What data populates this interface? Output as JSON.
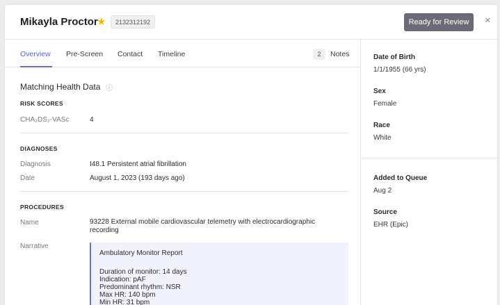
{
  "header": {
    "patient_name": "Mikayla Proctor",
    "patient_id": "2132312192",
    "ready_label": "Ready for Review",
    "close_symbol": "×"
  },
  "tabs": [
    {
      "label": "Overview",
      "active": true
    },
    {
      "label": "Pre-Screen",
      "active": false
    },
    {
      "label": "Contact",
      "active": false
    },
    {
      "label": "Timeline",
      "active": false
    }
  ],
  "notes": {
    "count": "2",
    "label": "Notes"
  },
  "main": {
    "section_title": "Matching Health Data",
    "risk_scores": {
      "heading": "RISK SCORES",
      "label": "CHA₂DS₂-VASc",
      "value": "4"
    },
    "diagnoses": {
      "heading": "DIAGNOSES",
      "diagnosis_label": "Diagnosis",
      "diagnosis_value": "I48.1 Persistent atrial fibrillation",
      "date_label": "Date",
      "date_value": "August 1, 2023 (193 days ago)"
    },
    "procedures": {
      "heading": "PROCEDURES",
      "name_label": "Name",
      "name_value": "93228 External mobile cardiovascular telemetry with electrocardiographic recording",
      "narrative_label": "Narrative",
      "report_title": "Ambulatory Monitor Report",
      "report_lines": [
        "Duration of monitor: 14 days",
        "Indication: pAF",
        "Predominant rhythm: NSR",
        "Max HR: 140 bpm",
        "Min HR: 31 bpm"
      ]
    }
  },
  "sidebar": {
    "dob_label": "Date of Birth",
    "dob_value": "1/1/1955 (66 yrs)",
    "sex_label": "Sex",
    "sex_value": "Female",
    "race_label": "Race",
    "race_value": "White",
    "added_label": "Added to Queue",
    "added_value": "Aug 2",
    "source_label": "Source",
    "source_value": "EHR (Epic)"
  }
}
